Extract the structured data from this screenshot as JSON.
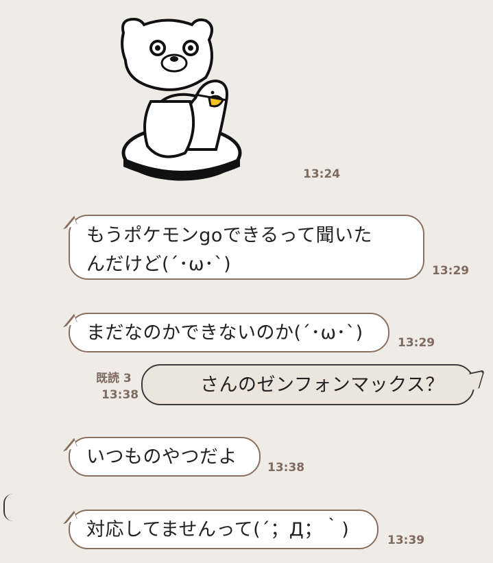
{
  "sticker": {
    "name": "bear-riding-duck-sticker",
    "time": "13:24"
  },
  "messages": [
    {
      "side": "left",
      "text_line1": "もうポケモンgoできるって聞いた",
      "text_line2": "んだけど(´･ω･`)",
      "time": "13:29"
    },
    {
      "side": "left",
      "text": "まだなのかできないのか(´･ω･`)",
      "time": "13:29"
    },
    {
      "side": "right",
      "text": "さんのゼンフォンマックス？",
      "read": "既読 3",
      "time": "13:38"
    },
    {
      "side": "left",
      "text": "いつものやつだよ",
      "time": "13:38"
    },
    {
      "side": "left",
      "text": "対応してませんって(´；Д；｀)",
      "time": "13:39"
    }
  ],
  "colors": {
    "background": "#efebe7",
    "bubble_border": "#8b6f5e",
    "time_text": "#7f6b5f"
  }
}
